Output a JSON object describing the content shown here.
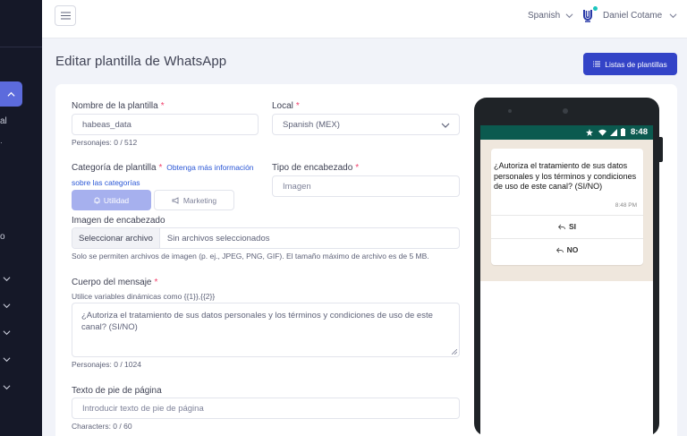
{
  "sidebar": {
    "texts": [
      "al",
      "o"
    ]
  },
  "header": {
    "language": "Spanish",
    "user_name": "Daniel Cotame"
  },
  "page": {
    "title": "Editar plantilla de WhatsApp",
    "list_button": "Listas de plantillas"
  },
  "form": {
    "name_label": "Nombre de la plantilla",
    "name_value": "habeas_data",
    "name_counter": "Personajes: 0 / 512",
    "locale_label": "Local",
    "locale_value": "Spanish (MEX)",
    "category_label": "Categoría de plantilla",
    "category_link_1": "Obtenga más información",
    "category_link_2": "sobre las categorías",
    "category_utility": "Utilidad",
    "category_marketing": "Marketing",
    "header_type_label": "Tipo de encabezado",
    "header_type_value": "Imagen",
    "header_image_label": "Imagen de encabezado",
    "file_button": "Seleccionar archivo",
    "file_none": "Sin archivos seleccionados",
    "file_help": "Solo se permiten archivos de imagen (p. ej., JPEG, PNG, GIF). El tamaño máximo de archivo es de 5 MB.",
    "body_label": "Cuerpo del mensaje",
    "body_help": "Utilice variables dinámicas como {{1}},{{2}}",
    "body_value": "¿Autoriza el tratamiento de sus datos personales y los términos y condiciones de uso de este canal? (SI/NO)",
    "body_counter": "Personajes: 0 / 1024",
    "footer_label": "Texto de pie de página",
    "footer_placeholder": "Introducir texto de pie de página",
    "footer_counter": "Characters: 0 / 60"
  },
  "preview": {
    "status_time": "8:48",
    "message": "¿Autoriza el tratamiento de sus datos personales y los términos y condiciones de uso de este canal? (SI/NO)",
    "message_time": "8:48 PM",
    "option_1": "SI",
    "option_2": "NO"
  },
  "colors": {
    "primary": "#3343c7",
    "sidebar": "#151828",
    "whatsapp_status": "#0b5a4f",
    "required": "#f1416c"
  }
}
